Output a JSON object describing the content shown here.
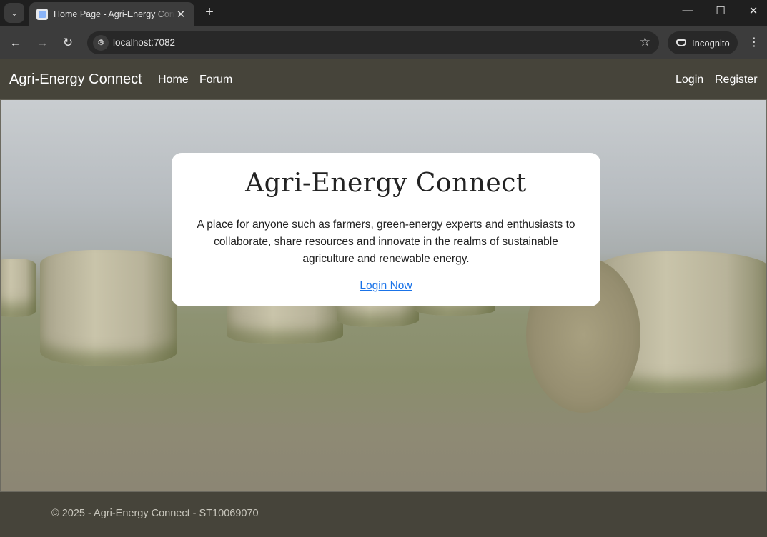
{
  "browser": {
    "tab_title": "Home Page - Agri-Energy Connect",
    "url": "localhost:7082",
    "incognito_label": "Incognito",
    "icons": [
      "tab-search-icon",
      "page-favicon",
      "close-tab-icon",
      "new-tab-icon",
      "minimize-icon",
      "maximize-icon",
      "close-window-icon",
      "back-icon",
      "forward-icon",
      "reload-icon",
      "site-info-icon",
      "bookmark-star-icon",
      "incognito-icon",
      "menu-icon"
    ]
  },
  "navbar": {
    "brand": "Agri-Energy Connect",
    "links": [
      "Home",
      "Forum"
    ],
    "auth": [
      "Login",
      "Register"
    ]
  },
  "hero": {
    "title": "Agri-Energy Connect",
    "description": "A place for anyone such as farmers, green-energy experts and enthusiasts to collaborate, share resources and innovate in the realms of sustainable agriculture and renewable energy.",
    "cta": "Login Now"
  },
  "footer": {
    "text": "© 2025 - Agri-Energy Connect - ST10069070"
  },
  "colors": {
    "navbar_bg": "#46443a",
    "link": "#1a73e8",
    "card_bg": "#ffffff"
  }
}
